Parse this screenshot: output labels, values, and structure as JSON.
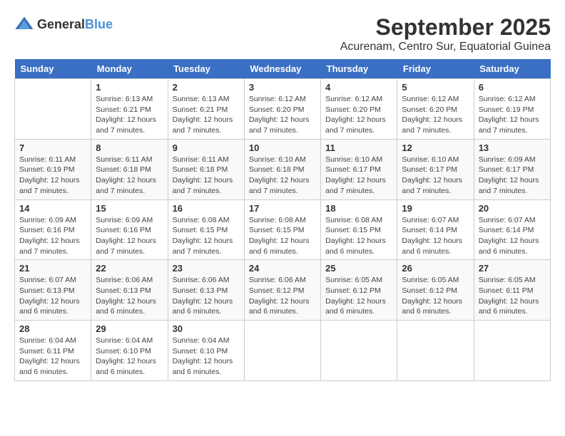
{
  "logo": {
    "general": "General",
    "blue": "Blue"
  },
  "title": "September 2025",
  "subtitle": "Acurenam, Centro Sur, Equatorial Guinea",
  "days_of_week": [
    "Sunday",
    "Monday",
    "Tuesday",
    "Wednesday",
    "Thursday",
    "Friday",
    "Saturday"
  ],
  "weeks": [
    [
      {
        "num": "",
        "info": ""
      },
      {
        "num": "1",
        "info": "Sunrise: 6:13 AM\nSunset: 6:21 PM\nDaylight: 12 hours\nand 7 minutes."
      },
      {
        "num": "2",
        "info": "Sunrise: 6:13 AM\nSunset: 6:21 PM\nDaylight: 12 hours\nand 7 minutes."
      },
      {
        "num": "3",
        "info": "Sunrise: 6:12 AM\nSunset: 6:20 PM\nDaylight: 12 hours\nand 7 minutes."
      },
      {
        "num": "4",
        "info": "Sunrise: 6:12 AM\nSunset: 6:20 PM\nDaylight: 12 hours\nand 7 minutes."
      },
      {
        "num": "5",
        "info": "Sunrise: 6:12 AM\nSunset: 6:20 PM\nDaylight: 12 hours\nand 7 minutes."
      },
      {
        "num": "6",
        "info": "Sunrise: 6:12 AM\nSunset: 6:19 PM\nDaylight: 12 hours\nand 7 minutes."
      }
    ],
    [
      {
        "num": "7",
        "info": "Sunrise: 6:11 AM\nSunset: 6:19 PM\nDaylight: 12 hours\nand 7 minutes."
      },
      {
        "num": "8",
        "info": "Sunrise: 6:11 AM\nSunset: 6:18 PM\nDaylight: 12 hours\nand 7 minutes."
      },
      {
        "num": "9",
        "info": "Sunrise: 6:11 AM\nSunset: 6:18 PM\nDaylight: 12 hours\nand 7 minutes."
      },
      {
        "num": "10",
        "info": "Sunrise: 6:10 AM\nSunset: 6:18 PM\nDaylight: 12 hours\nand 7 minutes."
      },
      {
        "num": "11",
        "info": "Sunrise: 6:10 AM\nSunset: 6:17 PM\nDaylight: 12 hours\nand 7 minutes."
      },
      {
        "num": "12",
        "info": "Sunrise: 6:10 AM\nSunset: 6:17 PM\nDaylight: 12 hours\nand 7 minutes."
      },
      {
        "num": "13",
        "info": "Sunrise: 6:09 AM\nSunset: 6:17 PM\nDaylight: 12 hours\nand 7 minutes."
      }
    ],
    [
      {
        "num": "14",
        "info": "Sunrise: 6:09 AM\nSunset: 6:16 PM\nDaylight: 12 hours\nand 7 minutes."
      },
      {
        "num": "15",
        "info": "Sunrise: 6:09 AM\nSunset: 6:16 PM\nDaylight: 12 hours\nand 7 minutes."
      },
      {
        "num": "16",
        "info": "Sunrise: 6:08 AM\nSunset: 6:15 PM\nDaylight: 12 hours\nand 7 minutes."
      },
      {
        "num": "17",
        "info": "Sunrise: 6:08 AM\nSunset: 6:15 PM\nDaylight: 12 hours\nand 6 minutes."
      },
      {
        "num": "18",
        "info": "Sunrise: 6:08 AM\nSunset: 6:15 PM\nDaylight: 12 hours\nand 6 minutes."
      },
      {
        "num": "19",
        "info": "Sunrise: 6:07 AM\nSunset: 6:14 PM\nDaylight: 12 hours\nand 6 minutes."
      },
      {
        "num": "20",
        "info": "Sunrise: 6:07 AM\nSunset: 6:14 PM\nDaylight: 12 hours\nand 6 minutes."
      }
    ],
    [
      {
        "num": "21",
        "info": "Sunrise: 6:07 AM\nSunset: 6:13 PM\nDaylight: 12 hours\nand 6 minutes."
      },
      {
        "num": "22",
        "info": "Sunrise: 6:06 AM\nSunset: 6:13 PM\nDaylight: 12 hours\nand 6 minutes."
      },
      {
        "num": "23",
        "info": "Sunrise: 6:06 AM\nSunset: 6:13 PM\nDaylight: 12 hours\nand 6 minutes."
      },
      {
        "num": "24",
        "info": "Sunrise: 6:06 AM\nSunset: 6:12 PM\nDaylight: 12 hours\nand 6 minutes."
      },
      {
        "num": "25",
        "info": "Sunrise: 6:05 AM\nSunset: 6:12 PM\nDaylight: 12 hours\nand 6 minutes."
      },
      {
        "num": "26",
        "info": "Sunrise: 6:05 AM\nSunset: 6:12 PM\nDaylight: 12 hours\nand 6 minutes."
      },
      {
        "num": "27",
        "info": "Sunrise: 6:05 AM\nSunset: 6:11 PM\nDaylight: 12 hours\nand 6 minutes."
      }
    ],
    [
      {
        "num": "28",
        "info": "Sunrise: 6:04 AM\nSunset: 6:11 PM\nDaylight: 12 hours\nand 6 minutes."
      },
      {
        "num": "29",
        "info": "Sunrise: 6:04 AM\nSunset: 6:10 PM\nDaylight: 12 hours\nand 6 minutes."
      },
      {
        "num": "30",
        "info": "Sunrise: 6:04 AM\nSunset: 6:10 PM\nDaylight: 12 hours\nand 6 minutes."
      },
      {
        "num": "",
        "info": ""
      },
      {
        "num": "",
        "info": ""
      },
      {
        "num": "",
        "info": ""
      },
      {
        "num": "",
        "info": ""
      }
    ]
  ]
}
